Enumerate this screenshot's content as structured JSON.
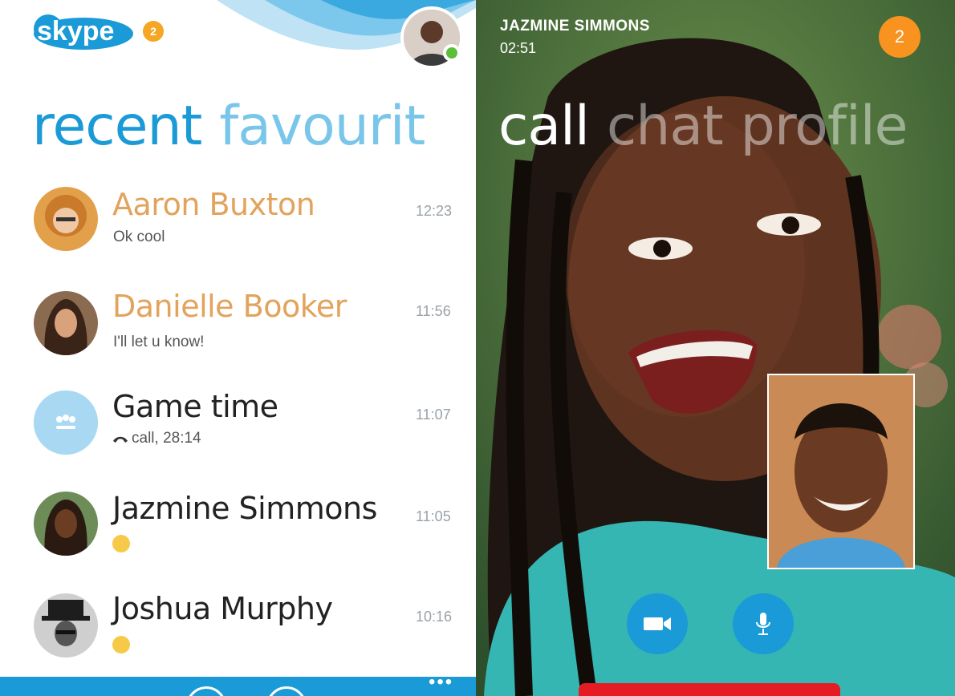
{
  "left": {
    "logo_text": "skype",
    "notification_count": "2",
    "pivot": {
      "active": "recent",
      "next": "favourit"
    },
    "conversations": [
      {
        "name": "Aaron Buxton",
        "preview": "Ok cool",
        "time": "12:23",
        "unread": true
      },
      {
        "name": "Danielle Booker",
        "preview": "I'll let u know!",
        "time": "11:56",
        "unread": true
      },
      {
        "name": "Game time",
        "preview": "call, 28:14",
        "time": "11:07",
        "unread": false
      },
      {
        "name": "Jazmine Simmons",
        "preview": "",
        "time": "11:05",
        "unread": false
      },
      {
        "name": "Joshua Murphy",
        "preview": "",
        "time": "10:16",
        "unread": false
      }
    ],
    "app_bar_more": "•••"
  },
  "call": {
    "caller_name": "JAZMINE SIMMONS",
    "timer": "02:51",
    "badge_count": "2",
    "pivot": {
      "active": "call",
      "item2": "chat",
      "item3": "profile"
    }
  },
  "colors": {
    "skype_blue": "#1a9ad6",
    "unread_name": "#e2a35c",
    "badge_orange": "#f7931e",
    "end_call_red": "#e51c23",
    "presence_green": "#5bbf3a"
  },
  "icons": [
    "skype-logo",
    "video-camera-icon",
    "microphone-icon",
    "phone-icon",
    "smiley-icon",
    "sunglasses-smiley-icon",
    "more-icon"
  ]
}
